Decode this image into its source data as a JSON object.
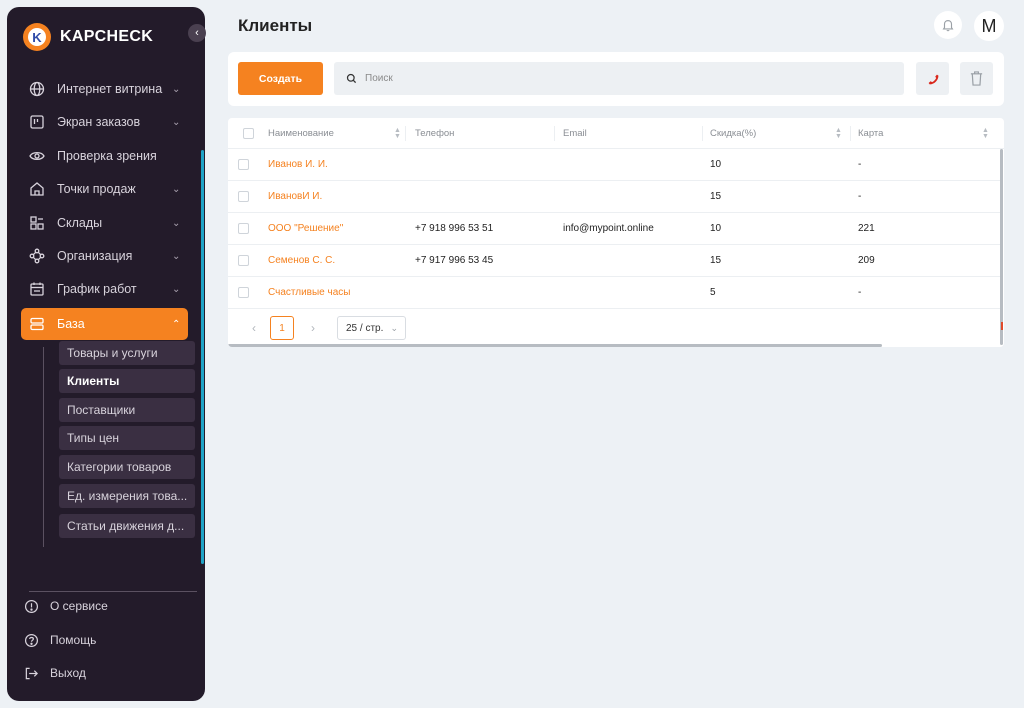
{
  "brand": {
    "name": "KAPCHECK",
    "badge_letter": "K",
    "accent": "#f58220"
  },
  "sidebar": {
    "items": [
      {
        "label": "Интернет витрина",
        "icon": "globe-icon",
        "expandable": true
      },
      {
        "label": "Экран заказов",
        "icon": "kanban-icon",
        "expandable": true
      },
      {
        "label": "Проверка зрения",
        "icon": "eye-icon",
        "expandable": false
      },
      {
        "label": "Точки продаж",
        "icon": "home-icon",
        "expandable": true
      },
      {
        "label": "Склады",
        "icon": "warehouse-icon",
        "expandable": true
      },
      {
        "label": "Организация",
        "icon": "organization-icon",
        "expandable": true
      },
      {
        "label": "График работ",
        "icon": "calendar-icon",
        "expandable": true
      },
      {
        "label": "База",
        "icon": "database-icon",
        "expandable": true,
        "active": true
      }
    ],
    "sub_items": [
      "Товары и услуги",
      "Клиенты",
      "Поставщики",
      "Типы цен",
      "Категории товаров",
      "Ед. измерения това...",
      "Статьи движения д..."
    ],
    "active_sub": "Клиенты",
    "footer": [
      {
        "label": "О сервисе",
        "icon": "info-icon"
      },
      {
        "label": "Помощь",
        "icon": "help-icon"
      },
      {
        "label": "Выход",
        "icon": "logout-icon"
      }
    ]
  },
  "header": {
    "title": "Клиенты",
    "avatar_letter": "M"
  },
  "toolbar": {
    "create_label": "Создать",
    "search_placeholder": "Поиск"
  },
  "table": {
    "columns": [
      "Наименование",
      "Телефон",
      "Email",
      "Скидка(%)",
      "Карта"
    ],
    "rows": [
      {
        "name": "Иванов И. И.",
        "phone": "",
        "email": "",
        "discount": "10",
        "card": "-"
      },
      {
        "name": "ИвановИ И.",
        "phone": "",
        "email": "",
        "discount": "15",
        "card": "-"
      },
      {
        "name": "ООО \"Решение\"",
        "phone": "+7 918 996 53 51",
        "email": "info@mypoint.online",
        "discount": "10",
        "card": "221"
      },
      {
        "name": "Семенов С. С.",
        "phone": "+7 917 996 53 45",
        "email": "",
        "discount": "15",
        "card": "209"
      },
      {
        "name": "Счастливые часы",
        "phone": "",
        "email": "",
        "discount": "5",
        "card": "-"
      }
    ]
  },
  "pagination": {
    "current_page": "1",
    "page_size": "25 / стр."
  }
}
